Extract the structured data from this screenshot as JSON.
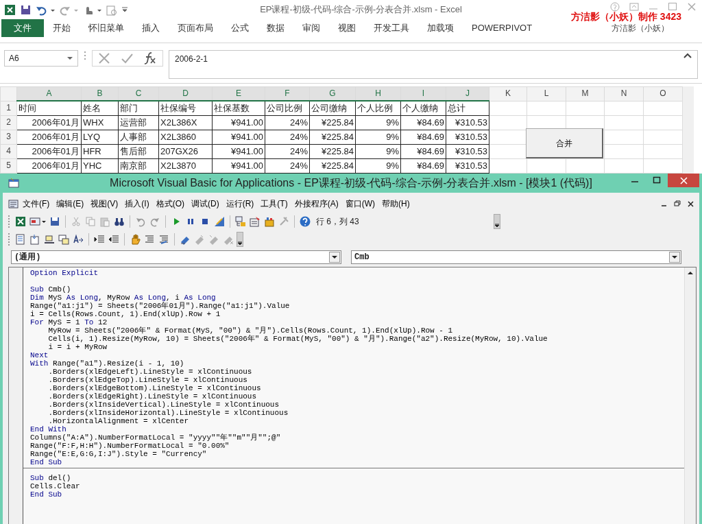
{
  "excel": {
    "title": "EP课程-初级-代码-综合-示例-分表合并.xlsm - Excel",
    "overlay_text": "方洁影（小妖）制作 3423",
    "ribbon_tabs": [
      {
        "label": "文件",
        "selected": true
      },
      {
        "label": "开始",
        "selected": false
      },
      {
        "label": "怀旧菜单",
        "selected": false
      },
      {
        "label": "插入",
        "selected": false
      },
      {
        "label": "页面布局",
        "selected": false
      },
      {
        "label": "公式",
        "selected": false
      },
      {
        "label": "数据",
        "selected": false
      },
      {
        "label": "审阅",
        "selected": false
      },
      {
        "label": "视图",
        "selected": false
      },
      {
        "label": "开发工具",
        "selected": false
      },
      {
        "label": "加载项",
        "selected": false
      },
      {
        "label": "POWERPIVOT",
        "selected": false
      }
    ],
    "user": "方洁影（小妖）",
    "name_box": "A6",
    "formula": "2006-2-1",
    "columns": [
      {
        "letter": "A",
        "selected": true,
        "kind": "number"
      },
      {
        "letter": "B",
        "selected": true,
        "kind": "text"
      },
      {
        "letter": "C",
        "selected": true,
        "kind": "text"
      },
      {
        "letter": "D",
        "selected": true,
        "kind": "text"
      },
      {
        "letter": "E",
        "selected": true,
        "kind": "number"
      },
      {
        "letter": "F",
        "selected": true,
        "kind": "number"
      },
      {
        "letter": "G",
        "selected": true,
        "kind": "number"
      },
      {
        "letter": "H",
        "selected": true,
        "kind": "number"
      },
      {
        "letter": "I",
        "selected": true,
        "kind": "number"
      },
      {
        "letter": "J",
        "selected": true,
        "kind": "number"
      },
      {
        "letter": "K",
        "selected": false
      },
      {
        "letter": "L",
        "selected": false
      },
      {
        "letter": "M",
        "selected": false
      },
      {
        "letter": "N",
        "selected": false
      },
      {
        "letter": "O",
        "selected": false
      }
    ],
    "rows": [
      {
        "number": "1",
        "cells": [
          "时间",
          "姓名",
          "部门",
          "社保编号",
          "社保基数",
          "公司比例",
          "公司缴纳",
          "个人比例",
          "个人缴纳",
          "总计"
        ]
      },
      {
        "number": "2",
        "cells": [
          "2006年01月",
          "WHX",
          "运营部",
          "X2L386X",
          "¥941.00",
          "24%",
          "¥225.84",
          "9%",
          "¥84.69",
          "¥310.53"
        ]
      },
      {
        "number": "3",
        "cells": [
          "2006年01月",
          "LYQ",
          "人事部",
          "X2L3860",
          "¥941.00",
          "24%",
          "¥225.84",
          "9%",
          "¥84.69",
          "¥310.53"
        ]
      },
      {
        "number": "4",
        "cells": [
          "2006年01月",
          "HFR",
          "售后部",
          "207GX26",
          "¥941.00",
          "24%",
          "¥225.84",
          "9%",
          "¥84.69",
          "¥310.53"
        ]
      },
      {
        "number": "5",
        "cells": [
          "2006年01月",
          "YHC",
          "南京部",
          "X2L3870",
          "¥941.00",
          "24%",
          "¥225.84",
          "9%",
          "¥84.69",
          "¥310.53"
        ]
      }
    ],
    "sheet_button": "合并"
  },
  "vba": {
    "title": "Microsoft Visual Basic for Applications - EP课程-初级-代码-综合-示例-分表合并.xlsm - [模块1 (代码)]",
    "menus": [
      "文件(F)",
      "编辑(E)",
      "视图(V)",
      "插入(I)",
      "格式(O)",
      "调试(D)",
      "运行(R)",
      "工具(T)",
      "外接程序(A)",
      "窗口(W)",
      "帮助(H)"
    ],
    "toolbar_1": [
      {
        "kind": "button",
        "disabled": false
      },
      {
        "kind": "button",
        "disabled": false
      },
      {
        "kind": "button",
        "disabled": false
      },
      {
        "kind": "separator"
      },
      {
        "kind": "button",
        "disabled": true
      },
      {
        "kind": "button",
        "disabled": true
      },
      {
        "kind": "button",
        "disabled": true
      },
      {
        "kind": "button",
        "disabled": false
      },
      {
        "kind": "separator"
      },
      {
        "kind": "button",
        "disabled": true
      },
      {
        "kind": "button",
        "disabled": true
      },
      {
        "kind": "separator"
      },
      {
        "kind": "button",
        "disabled": false
      },
      {
        "kind": "button",
        "disabled": false
      },
      {
        "kind": "button",
        "disabled": false
      },
      {
        "kind": "button",
        "disabled": false
      },
      {
        "kind": "separator"
      },
      {
        "kind": "button",
        "disabled": false
      },
      {
        "kind": "button",
        "disabled": false
      },
      {
        "kind": "button",
        "disabled": false
      },
      {
        "kind": "button",
        "disabled": true
      },
      {
        "kind": "separator"
      },
      {
        "kind": "button",
        "disabled": false
      },
      {
        "kind": "text",
        "text": "行 6，列 43"
      }
    ],
    "toolbar_2": [
      {
        "kind": "button",
        "disabled": false
      },
      {
        "kind": "button",
        "disabled": false
      },
      {
        "kind": "button",
        "disabled": false
      },
      {
        "kind": "button",
        "disabled": false
      },
      {
        "kind": "button",
        "disabled": false
      },
      {
        "kind": "separator"
      },
      {
        "kind": "button",
        "disabled": false
      },
      {
        "kind": "button",
        "disabled": false
      },
      {
        "kind": "separator"
      },
      {
        "kind": "button",
        "disabled": false
      },
      {
        "kind": "button",
        "disabled": false
      },
      {
        "kind": "button",
        "disabled": false
      },
      {
        "kind": "separator"
      },
      {
        "kind": "button",
        "disabled": false
      },
      {
        "kind": "button",
        "disabled": true
      },
      {
        "kind": "button",
        "disabled": true
      },
      {
        "kind": "button",
        "disabled": true
      }
    ],
    "object_box": "(通用)",
    "procedure_box": "Cmb",
    "sections": [
      {
        "lines": [
          {
            "parts": [
              {
                "text": "Option Explicit",
                "keyword": true
              }
            ]
          },
          {
            "kind": "blank"
          },
          {
            "parts": [
              {
                "text": "Sub",
                "keyword": true
              },
              {
                "text": " Cmb()",
                "keyword": false
              }
            ]
          },
          {
            "parts": [
              {
                "text": "Dim",
                "keyword": true
              },
              {
                "text": " MyS ",
                "keyword": false
              },
              {
                "text": "As Long",
                "keyword": true
              },
              {
                "text": ", MyRow ",
                "keyword": false
              },
              {
                "text": "As Long",
                "keyword": true
              },
              {
                "text": ", i ",
                "keyword": false
              },
              {
                "text": "As Long",
                "keyword": true
              }
            ]
          },
          {
            "parts": [
              {
                "text": "Range(\"a1:j1\") = Sheets(\"2006年01月\").Range(\"a1:j1\").Value",
                "keyword": false
              }
            ]
          },
          {
            "parts": [
              {
                "text": "i = Cells(Rows.Count, 1).End(xlUp).Row + 1",
                "keyword": false
              }
            ]
          },
          {
            "parts": [
              {
                "text": "For",
                "keyword": true
              },
              {
                "text": " MyS = 1 ",
                "keyword": false
              },
              {
                "text": "To",
                "keyword": true
              },
              {
                "text": " 12",
                "keyword": false
              }
            ]
          },
          {
            "parts": [
              {
                "text": "    MyRow = Sheets(\"2006年\" & Format(MyS, \"00\") & \"月\").Cells(Rows.Count, 1).End(xlUp).Row - 1",
                "keyword": false
              }
            ]
          },
          {
            "parts": [
              {
                "text": "    Cells(i, 1).Resize(MyRow, 10) = Sheets(\"2006年\" & Format(MyS, \"00\") & \"月\").Range(\"a2\").Resize(MyRow, 10).Value",
                "keyword": false
              }
            ]
          },
          {
            "parts": [
              {
                "text": "    i = i + MyRow",
                "keyword": false
              }
            ]
          },
          {
            "parts": [
              {
                "text": "Next",
                "keyword": true
              }
            ]
          },
          {
            "parts": [
              {
                "text": "With",
                "keyword": true
              },
              {
                "text": " Range(\"a1\").Resize(i - 1, 10)",
                "keyword": false
              }
            ]
          },
          {
            "parts": [
              {
                "text": "    .Borders(xlEdgeLeft).LineStyle = xlContinuous",
                "keyword": false
              }
            ]
          },
          {
            "parts": [
              {
                "text": "    .Borders(xlEdgeTop).LineStyle = xlContinuous",
                "keyword": false
              }
            ]
          },
          {
            "parts": [
              {
                "text": "    .Borders(xlEdgeBottom).LineStyle = xlContinuous",
                "keyword": false
              }
            ]
          },
          {
            "parts": [
              {
                "text": "    .Borders(xlEdgeRight).LineStyle = xlContinuous",
                "keyword": false
              }
            ]
          },
          {
            "parts": [
              {
                "text": "    .Borders(xlInsideVertical).LineStyle = xlContinuous",
                "keyword": false
              }
            ]
          },
          {
            "parts": [
              {
                "text": "    .Borders(xlInsideHorizontal).LineStyle = xlContinuous",
                "keyword": false
              }
            ]
          },
          {
            "parts": [
              {
                "text": "    .HorizontalAlignment = xlCenter",
                "keyword": false
              }
            ]
          },
          {
            "parts": [
              {
                "text": "End With",
                "keyword": true
              }
            ]
          },
          {
            "parts": [
              {
                "text": "Columns(\"A:A\").NumberFormatLocal = \"yyyy\"\"年\"\"m\"\"月\"\";@\"",
                "keyword": false
              }
            ]
          },
          {
            "parts": [
              {
                "text": "Range(\"F:F,H:H\").NumberFormatLocal = \"0.00%\"",
                "keyword": false
              }
            ]
          },
          {
            "parts": [
              {
                "text": "Range(\"E:E,G:G,I:J\").Style = \"Currency\"",
                "keyword": false
              }
            ]
          },
          {
            "parts": [
              {
                "text": "End Sub",
                "keyword": true
              }
            ]
          }
        ]
      },
      {
        "lines": [
          {
            "parts": [
              {
                "text": "Sub",
                "keyword": true
              },
              {
                "text": " del()",
                "keyword": false
              }
            ]
          },
          {
            "parts": [
              {
                "text": "Cells.Clear",
                "keyword": false
              }
            ]
          },
          {
            "parts": [
              {
                "text": "End Sub",
                "keyword": true
              }
            ]
          }
        ]
      }
    ]
  }
}
